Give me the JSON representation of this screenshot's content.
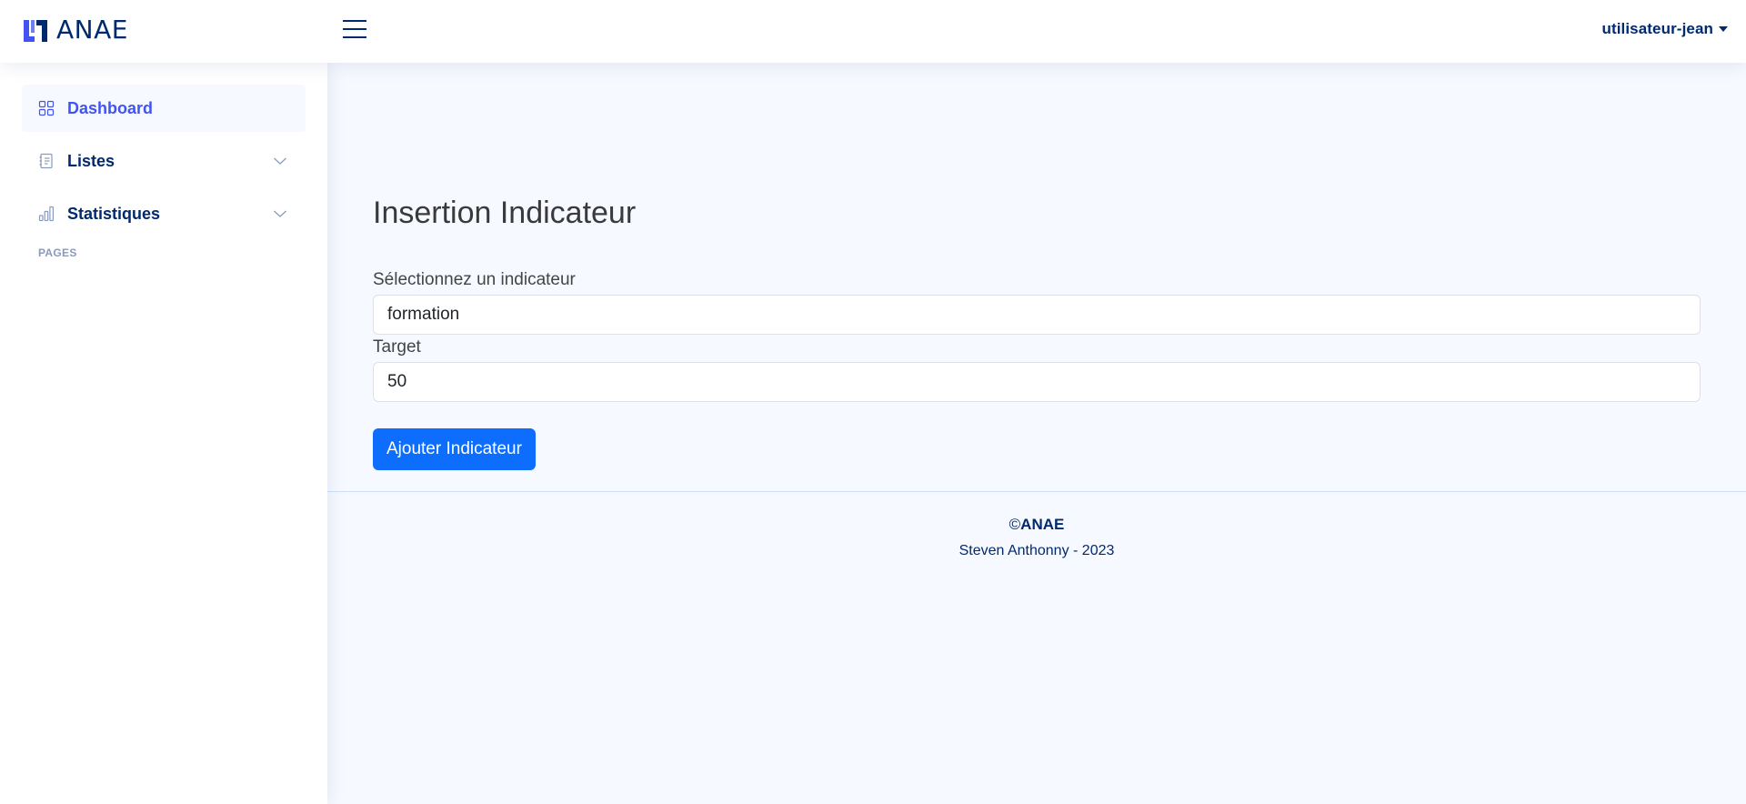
{
  "header": {
    "logo_text": "ANAE",
    "user_name": "utilisateur-jean"
  },
  "sidebar": {
    "items": [
      {
        "label": "Dashboard",
        "icon": "grid-icon",
        "active": true
      },
      {
        "label": "Listes",
        "icon": "journal-text-icon",
        "has_chevron": true
      },
      {
        "label": "Statistiques",
        "icon": "bar-chart-icon",
        "has_chevron": true
      }
    ],
    "heading": "Pages"
  },
  "main": {
    "title": "Insertion Indicateur",
    "indicator_label": "Sélectionnez un indicateur",
    "indicator_value": "formation",
    "target_label": "Target",
    "target_value": "50",
    "submit_label": "Ajouter Indicateur"
  },
  "footer": {
    "copyright_symbol": "©",
    "copyright_brand": "ANAE",
    "credits": "Steven Anthonny - 2023"
  },
  "colors": {
    "primary": "#0d6efd",
    "brand": "#012970",
    "accent": "#4154f1",
    "background": "#f6f9ff"
  }
}
